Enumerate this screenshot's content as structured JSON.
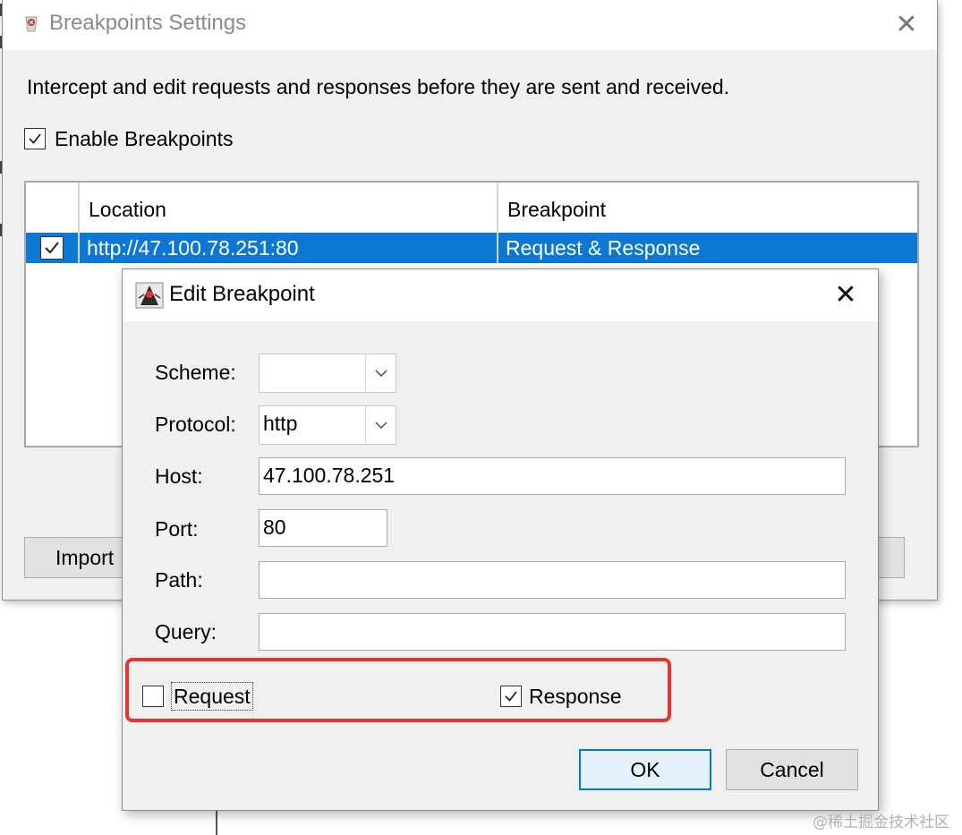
{
  "breakpoints_settings": {
    "title": "Breakpoints Settings",
    "close_glyph": "✕",
    "description": "Intercept and edit requests and responses before they are sent and received.",
    "enable_label": "Enable Breakpoints",
    "enable_checked": true,
    "table": {
      "columns": [
        "Location",
        "Breakpoint"
      ],
      "rows": [
        {
          "checked": true,
          "location": "http://47.100.78.251:80",
          "breakpoint": "Request & Response"
        }
      ]
    },
    "import_label": "Import"
  },
  "edit_breakpoint": {
    "title": "Edit Breakpoint",
    "close_glyph": "✕",
    "fields": {
      "scheme_label": "Scheme:",
      "scheme_value": "",
      "protocol_label": "Protocol:",
      "protocol_value": "http",
      "host_label": "Host:",
      "host_value": "47.100.78.251",
      "port_label": "Port:",
      "port_value": "80",
      "path_label": "Path:",
      "path_value": "",
      "query_label": "Query:",
      "query_value": ""
    },
    "request_label": "Request",
    "request_checked": false,
    "response_label": "Response",
    "response_checked": true,
    "ok_label": "OK",
    "cancel_label": "Cancel"
  },
  "watermark": "@稀土掘金技术社区",
  "colors": {
    "selection": "#0c78d4",
    "highlight": "#e8332f",
    "default_button_border": "#0078d7"
  },
  "icons": [
    "app-icon",
    "close-icon",
    "check-icon",
    "java-duke-icon",
    "chevron-down-icon"
  ]
}
